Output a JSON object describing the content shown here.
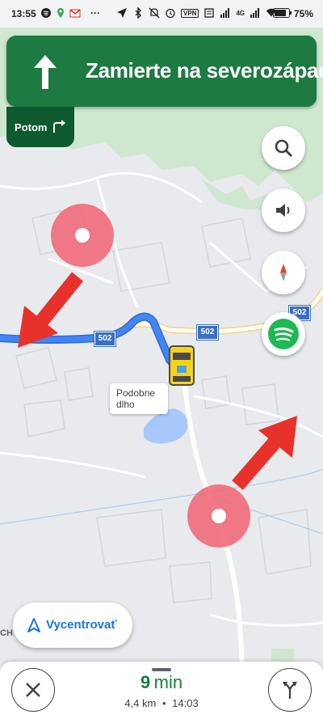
{
  "status_bar": {
    "time": "13:55",
    "battery": "75",
    "network": "4G",
    "vpn": "VPN"
  },
  "navigation": {
    "instruction": "Zamierte na severozápad",
    "then_label": "Potom"
  },
  "map": {
    "road_number": "502",
    "poi_label_line1": "Podobne",
    "poi_label_line2": "dlho",
    "edge_label": "CH"
  },
  "buttons": {
    "recenter_label": "Vycentrovať"
  },
  "trip": {
    "duration_value": "9",
    "duration_unit": "min",
    "distance": "4,4 km",
    "separator": "•",
    "arrival_time": "14:03"
  },
  "colors": {
    "banner": "#1e7a43",
    "banner_secondary": "#0e5a30",
    "route": "#4285f4",
    "eta": "#188038",
    "annotation_arrow": "#e8312a",
    "annotation_circle": "#ef6a7a"
  },
  "icons": [
    "arrow-up-icon",
    "turn-right-icon",
    "search-icon",
    "volume-icon",
    "compass-icon",
    "spotify-icon",
    "navigation-arrow-icon",
    "close-icon",
    "alternate-routes-icon",
    "car-icon"
  ]
}
